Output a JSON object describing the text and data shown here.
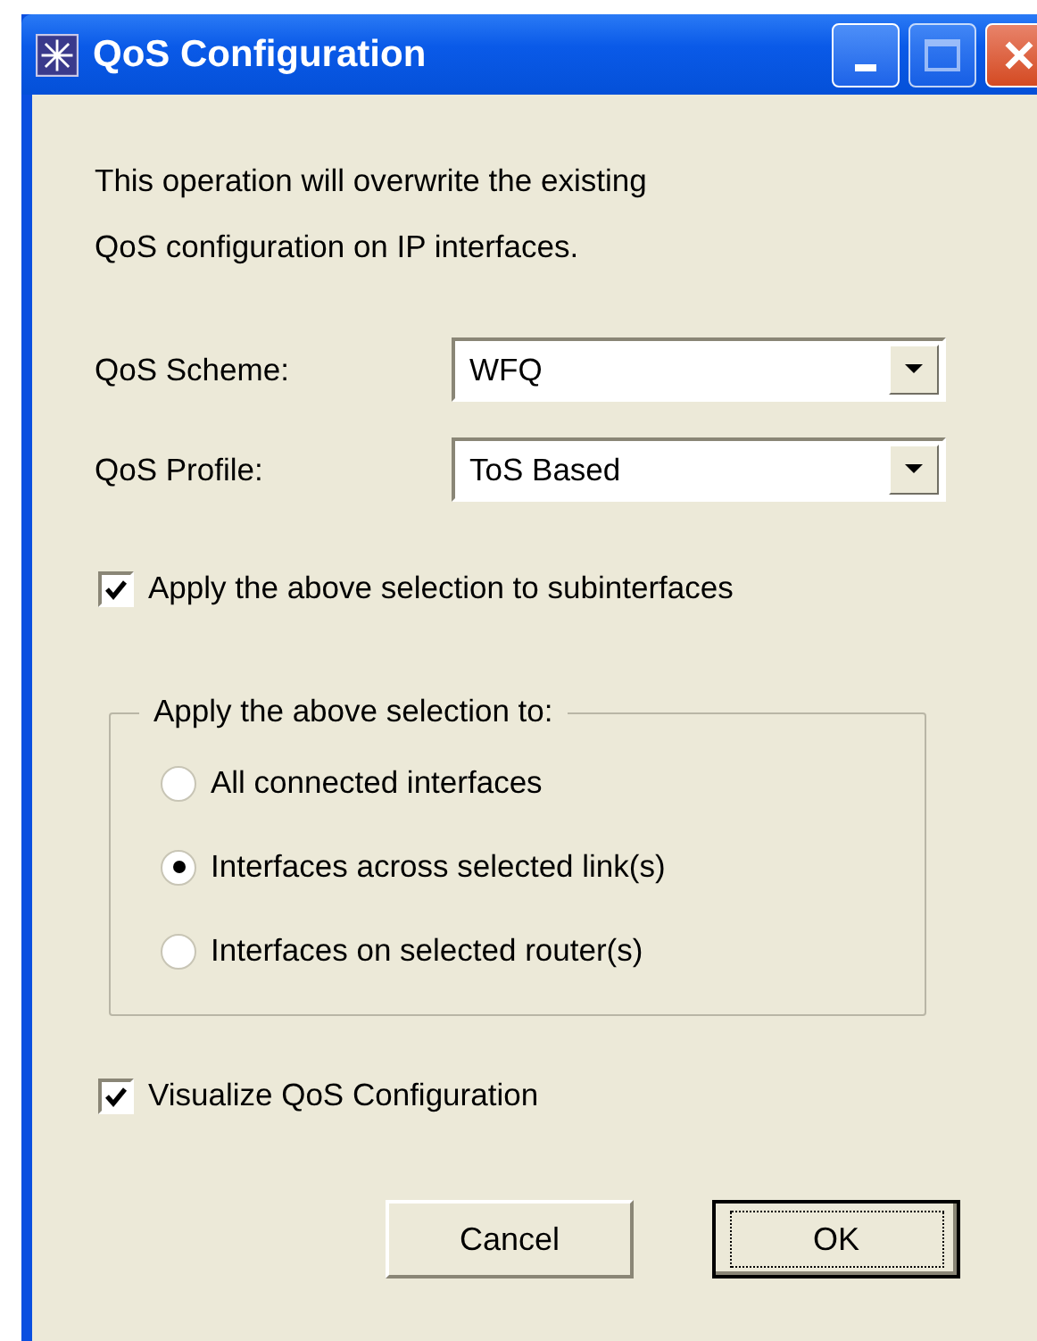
{
  "window": {
    "title": "QoS Configuration"
  },
  "message": [
    "This operation will overwrite the existing",
    "QoS configuration on IP interfaces."
  ],
  "fields": [
    {
      "label": "QoS Scheme:",
      "value": "WFQ"
    },
    {
      "label": "QoS Profile:",
      "value": "ToS Based"
    }
  ],
  "subinterfaces": {
    "label": "Apply the above selection to subinterfaces",
    "checked": true
  },
  "group": {
    "title": "Apply the above selection to:",
    "options": [
      {
        "label": "All connected interfaces",
        "selected": false
      },
      {
        "label": "Interfaces across selected link(s)",
        "selected": true
      },
      {
        "label": "Interfaces on selected router(s)",
        "selected": false
      }
    ]
  },
  "visualize": {
    "label": "Visualize QoS Configuration",
    "checked": true
  },
  "buttons": [
    {
      "label": "Cancel",
      "default": false
    },
    {
      "label": "OK",
      "default": true
    }
  ]
}
